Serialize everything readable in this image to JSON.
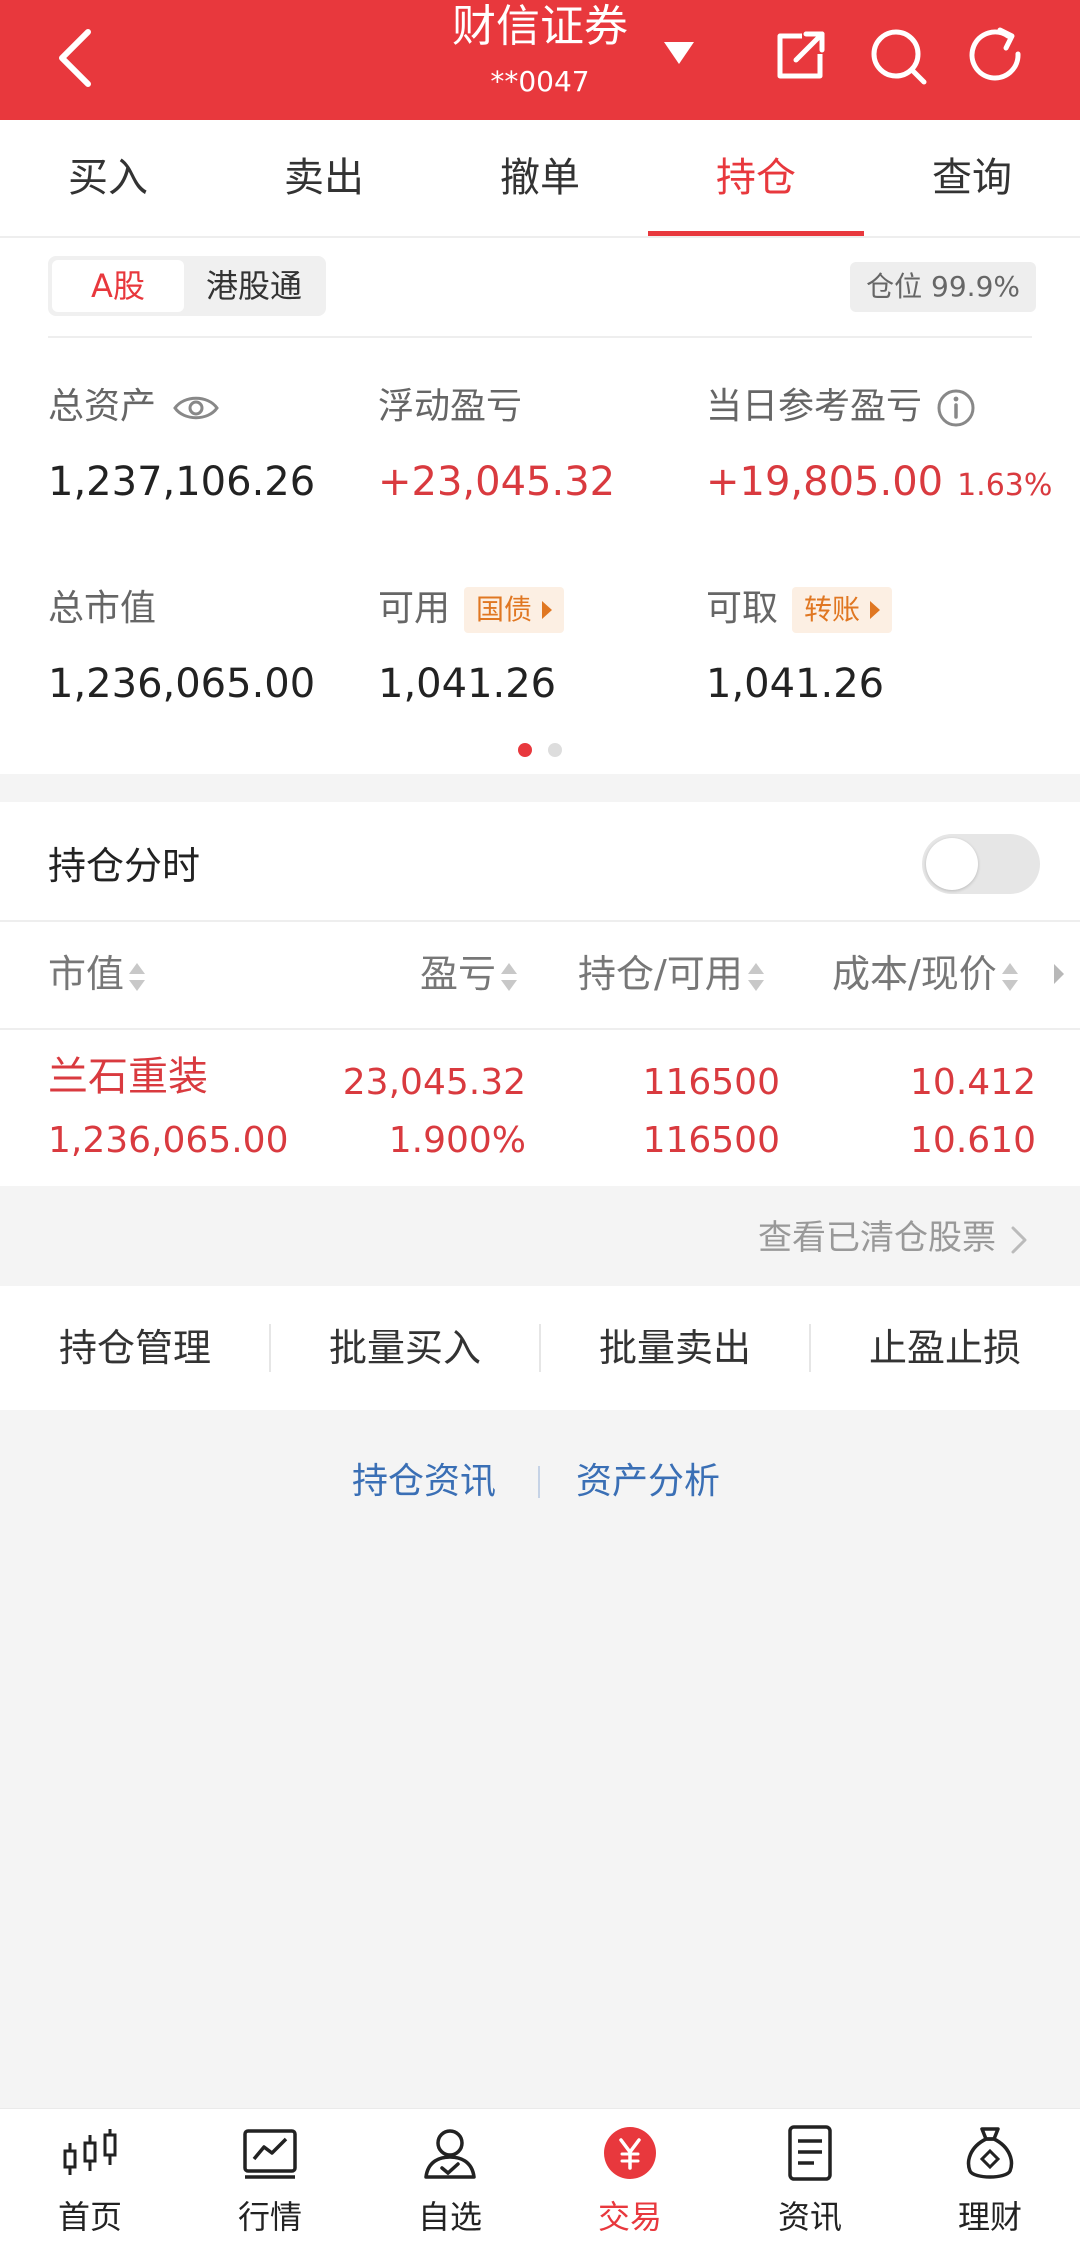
{
  "header": {
    "title": "财信证券",
    "account": "**0047"
  },
  "tabs": [
    "买入",
    "卖出",
    "撤单",
    "持仓",
    "查询"
  ],
  "market_tabs": {
    "a_share": "A股",
    "hk_connect": "港股通"
  },
  "position_badge": "仓位 99.9%",
  "metrics": {
    "total_assets": {
      "label": "总资产",
      "value": "1,237,106.26"
    },
    "floating_pnl": {
      "label": "浮动盈亏",
      "value": "+23,045.32"
    },
    "daily_pnl": {
      "label": "当日参考盈亏",
      "value": "+19,805.00",
      "pct": "1.63%"
    },
    "market_value": {
      "label": "总市值",
      "value": "1,236,065.00"
    },
    "available": {
      "label": "可用",
      "tag": "国债",
      "value": "1,041.26"
    },
    "withdrawable": {
      "label": "可取",
      "tag": "转账",
      "value": "1,041.26"
    }
  },
  "holding_intraday": {
    "label": "持仓分时",
    "toggle_on": false
  },
  "table": {
    "headers": {
      "market_value": "市值",
      "pnl": "盈亏",
      "position": "持仓/可用",
      "cost": "成本/现价"
    },
    "rows": [
      {
        "name": "兰石重装",
        "market_value": "1,236,065.00",
        "pnl": "23,045.32",
        "pnl_pct": "1.900%",
        "position": "116500",
        "available": "116500",
        "cost": "10.412",
        "price": "10.610"
      }
    ]
  },
  "cleared_link": "查看已清仓股票",
  "actions": [
    "持仓管理",
    "批量买入",
    "批量卖出",
    "止盈止损"
  ],
  "links": {
    "news": "持仓资讯",
    "analysis": "资产分析"
  },
  "bottom_nav": [
    "首页",
    "行情",
    "自选",
    "交易",
    "资讯",
    "理财"
  ],
  "colors": {
    "brand_red": "#e8383d",
    "gain_red": "#d93a3f",
    "tag_orange": "#e07722",
    "link_blue": "#3a6fb5"
  }
}
